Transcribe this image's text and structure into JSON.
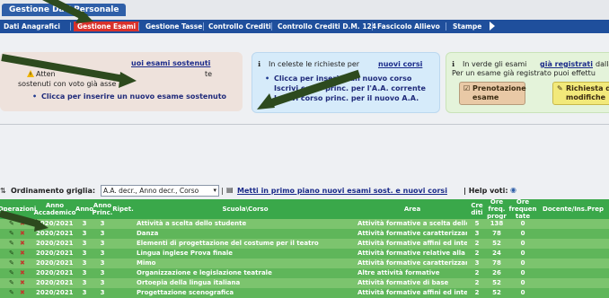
{
  "app": {
    "tab_label": "Gestione Dati Personale"
  },
  "menu": {
    "items": [
      {
        "label": "Dati Anagrafici"
      },
      {
        "label": "Gestione Esami",
        "active": true
      },
      {
        "label": "Gestione Tasse"
      },
      {
        "label": "Controllo Crediti"
      },
      {
        "label": "Controllo Crediti D.M. 124"
      },
      {
        "label": "Fascicolo Allievo"
      },
      {
        "label": "Stampe"
      }
    ]
  },
  "panels": {
    "exams": {
      "heading": "uoi esami sostenuti",
      "line1": "Atten",
      "line1b": "te",
      "line2": "sostenuti con voto già asse",
      "link": "Clicca per inserire un nuovo esame sostenuto"
    },
    "courses": {
      "heading_prefix": "In celeste le richieste per",
      "heading_link": "nuovi corsi",
      "link1": "Clicca per inserire un nuovo corso",
      "link2": "Iscrivi corso princ. per l'A.A. corrente",
      "link3": "Iscrivi corso princ. per il nuovo A.A."
    },
    "registered": {
      "heading_prefix": "In verde gli esami",
      "heading_link": "già registrati",
      "heading_suffix": "dalla",
      "line2": "Per un esame già registrato puoi effettu",
      "btn_booking": "Prenotazione esame",
      "btn_request": "Richiesta di modifiche"
    }
  },
  "order": {
    "label": "Ordinamento griglia:",
    "value": "A.A. decr., Anno decr., Corso",
    "link": "Metti in primo piano nuovi esami sost. e nuovi corsi",
    "help": "| Help voti:"
  },
  "table": {
    "headers": [
      "Operazioni",
      "Anno Accademico",
      "Anno",
      "Anno Princ.",
      "Ripet.",
      "Scuola\\Corso",
      "Area",
      "Cre diti",
      "Ore freq. progr",
      "Ore frequen tate",
      "Docente/Ins.Prep"
    ],
    "rows": [
      {
        "aa": "2020/2021",
        "anno": "3",
        "princ": "3",
        "corso": "Attività a scelta dello studente",
        "area": "Attività formative a scelta dello stu",
        "crediti": "5",
        "ore": "138",
        "freq": "0"
      },
      {
        "aa": "2020/2021",
        "anno": "3",
        "princ": "3",
        "corso": "Danza",
        "area": "Attività formative caratterizzanti",
        "crediti": "3",
        "ore": "78",
        "freq": "0"
      },
      {
        "aa": "2020/2021",
        "anno": "3",
        "princ": "3",
        "corso": "Elementi di progettazione del costume per il teatro",
        "area": "Attività formative affini ed integrat",
        "crediti": "2",
        "ore": "52",
        "freq": "0"
      },
      {
        "aa": "2020/2021",
        "anno": "3",
        "princ": "3",
        "corso": "Lingua inglese Prova finale",
        "area": "Attività formative relative alla lingu",
        "crediti": "2",
        "ore": "24",
        "freq": "0"
      },
      {
        "aa": "2020/2021",
        "anno": "3",
        "princ": "3",
        "corso": "Mimo",
        "area": "Attività formative caratterizzanti",
        "crediti": "3",
        "ore": "78",
        "freq": "0"
      },
      {
        "aa": "2020/2021",
        "anno": "3",
        "princ": "3",
        "corso": "Organizzazione e legislazione teatrale",
        "area": "Altre attività formative",
        "crediti": "2",
        "ore": "26",
        "freq": "0"
      },
      {
        "aa": "2020/2021",
        "anno": "3",
        "princ": "3",
        "corso": "Ortoepia della lingua italiana",
        "area": "Attività formative di base",
        "crediti": "2",
        "ore": "52",
        "freq": "0"
      },
      {
        "aa": "2020/2021",
        "anno": "3",
        "princ": "3",
        "corso": "Progettazione scenografica",
        "area": "Attività formative affini ed integrat",
        "crediti": "2",
        "ore": "52",
        "freq": "0"
      }
    ]
  },
  "colors": {
    "menu_bg": "#1f4f9c",
    "active_menu": "#d9312b",
    "header_green": "#3aa84a",
    "arrow": "#2d4a1e"
  }
}
